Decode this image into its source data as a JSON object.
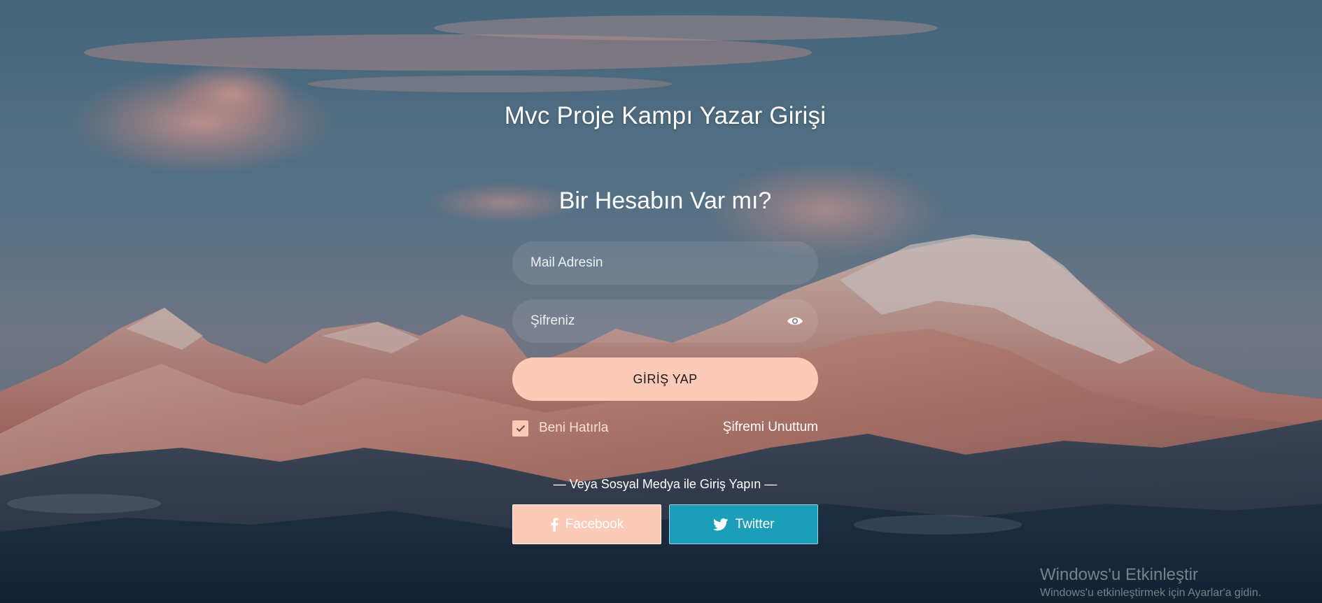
{
  "page": {
    "title": "Mvc Proje Kampı Yazar Girişi"
  },
  "form": {
    "heading": "Bir Hesabın Var mı?",
    "email_placeholder": "Mail Adresin",
    "password_placeholder": "Şifreniz",
    "submit_label": "GİRİŞ YAP",
    "remember_label": "Beni Hatırla",
    "remember_checked": true,
    "forgot_label": "Şifremi Unuttum"
  },
  "social": {
    "label": "— Veya Sosyal Medya ile Giriş Yapın —",
    "facebook_label": "Facebook",
    "facebook_icon": "facebook-icon",
    "twitter_label": "Twitter",
    "twitter_icon": "twitter-icon"
  },
  "watermark": {
    "title": "Windows'u Etkinleştir",
    "subtitle": "Windows'u etkinleştirmek için Ayarlar'a gidin."
  },
  "colors": {
    "accent_peach": "#fccbb7",
    "twitter_blue": "#1d9eb8",
    "text_white": "#ffffff"
  }
}
